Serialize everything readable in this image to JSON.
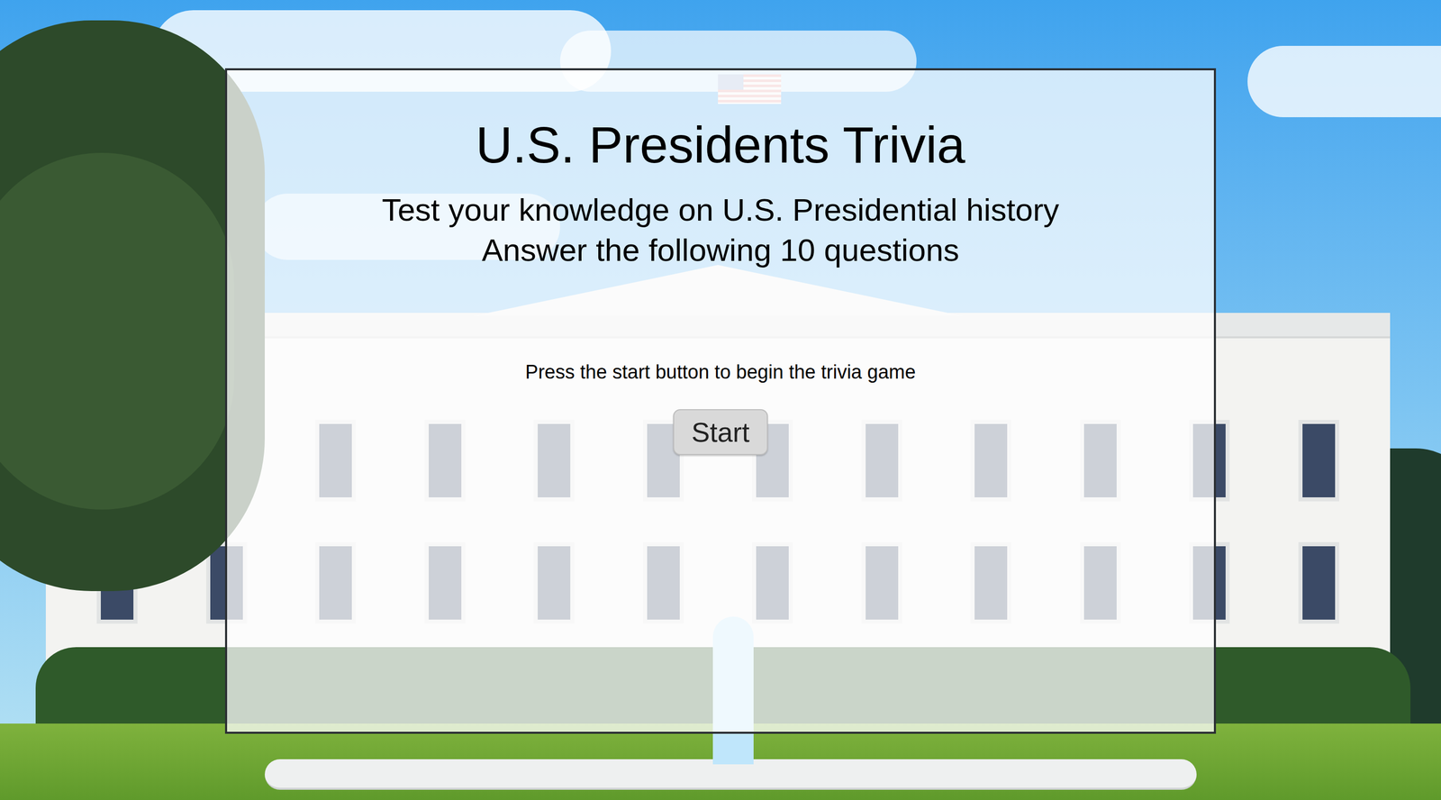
{
  "title": "U.S. Presidents Trivia",
  "subtitle_lines": [
    "Test your knowledge on U.S. Presidential history",
    "Answer the following 10 questions"
  ],
  "instruction": "Press the start button to begin the trivia game",
  "start_button": {
    "label": "Start"
  }
}
